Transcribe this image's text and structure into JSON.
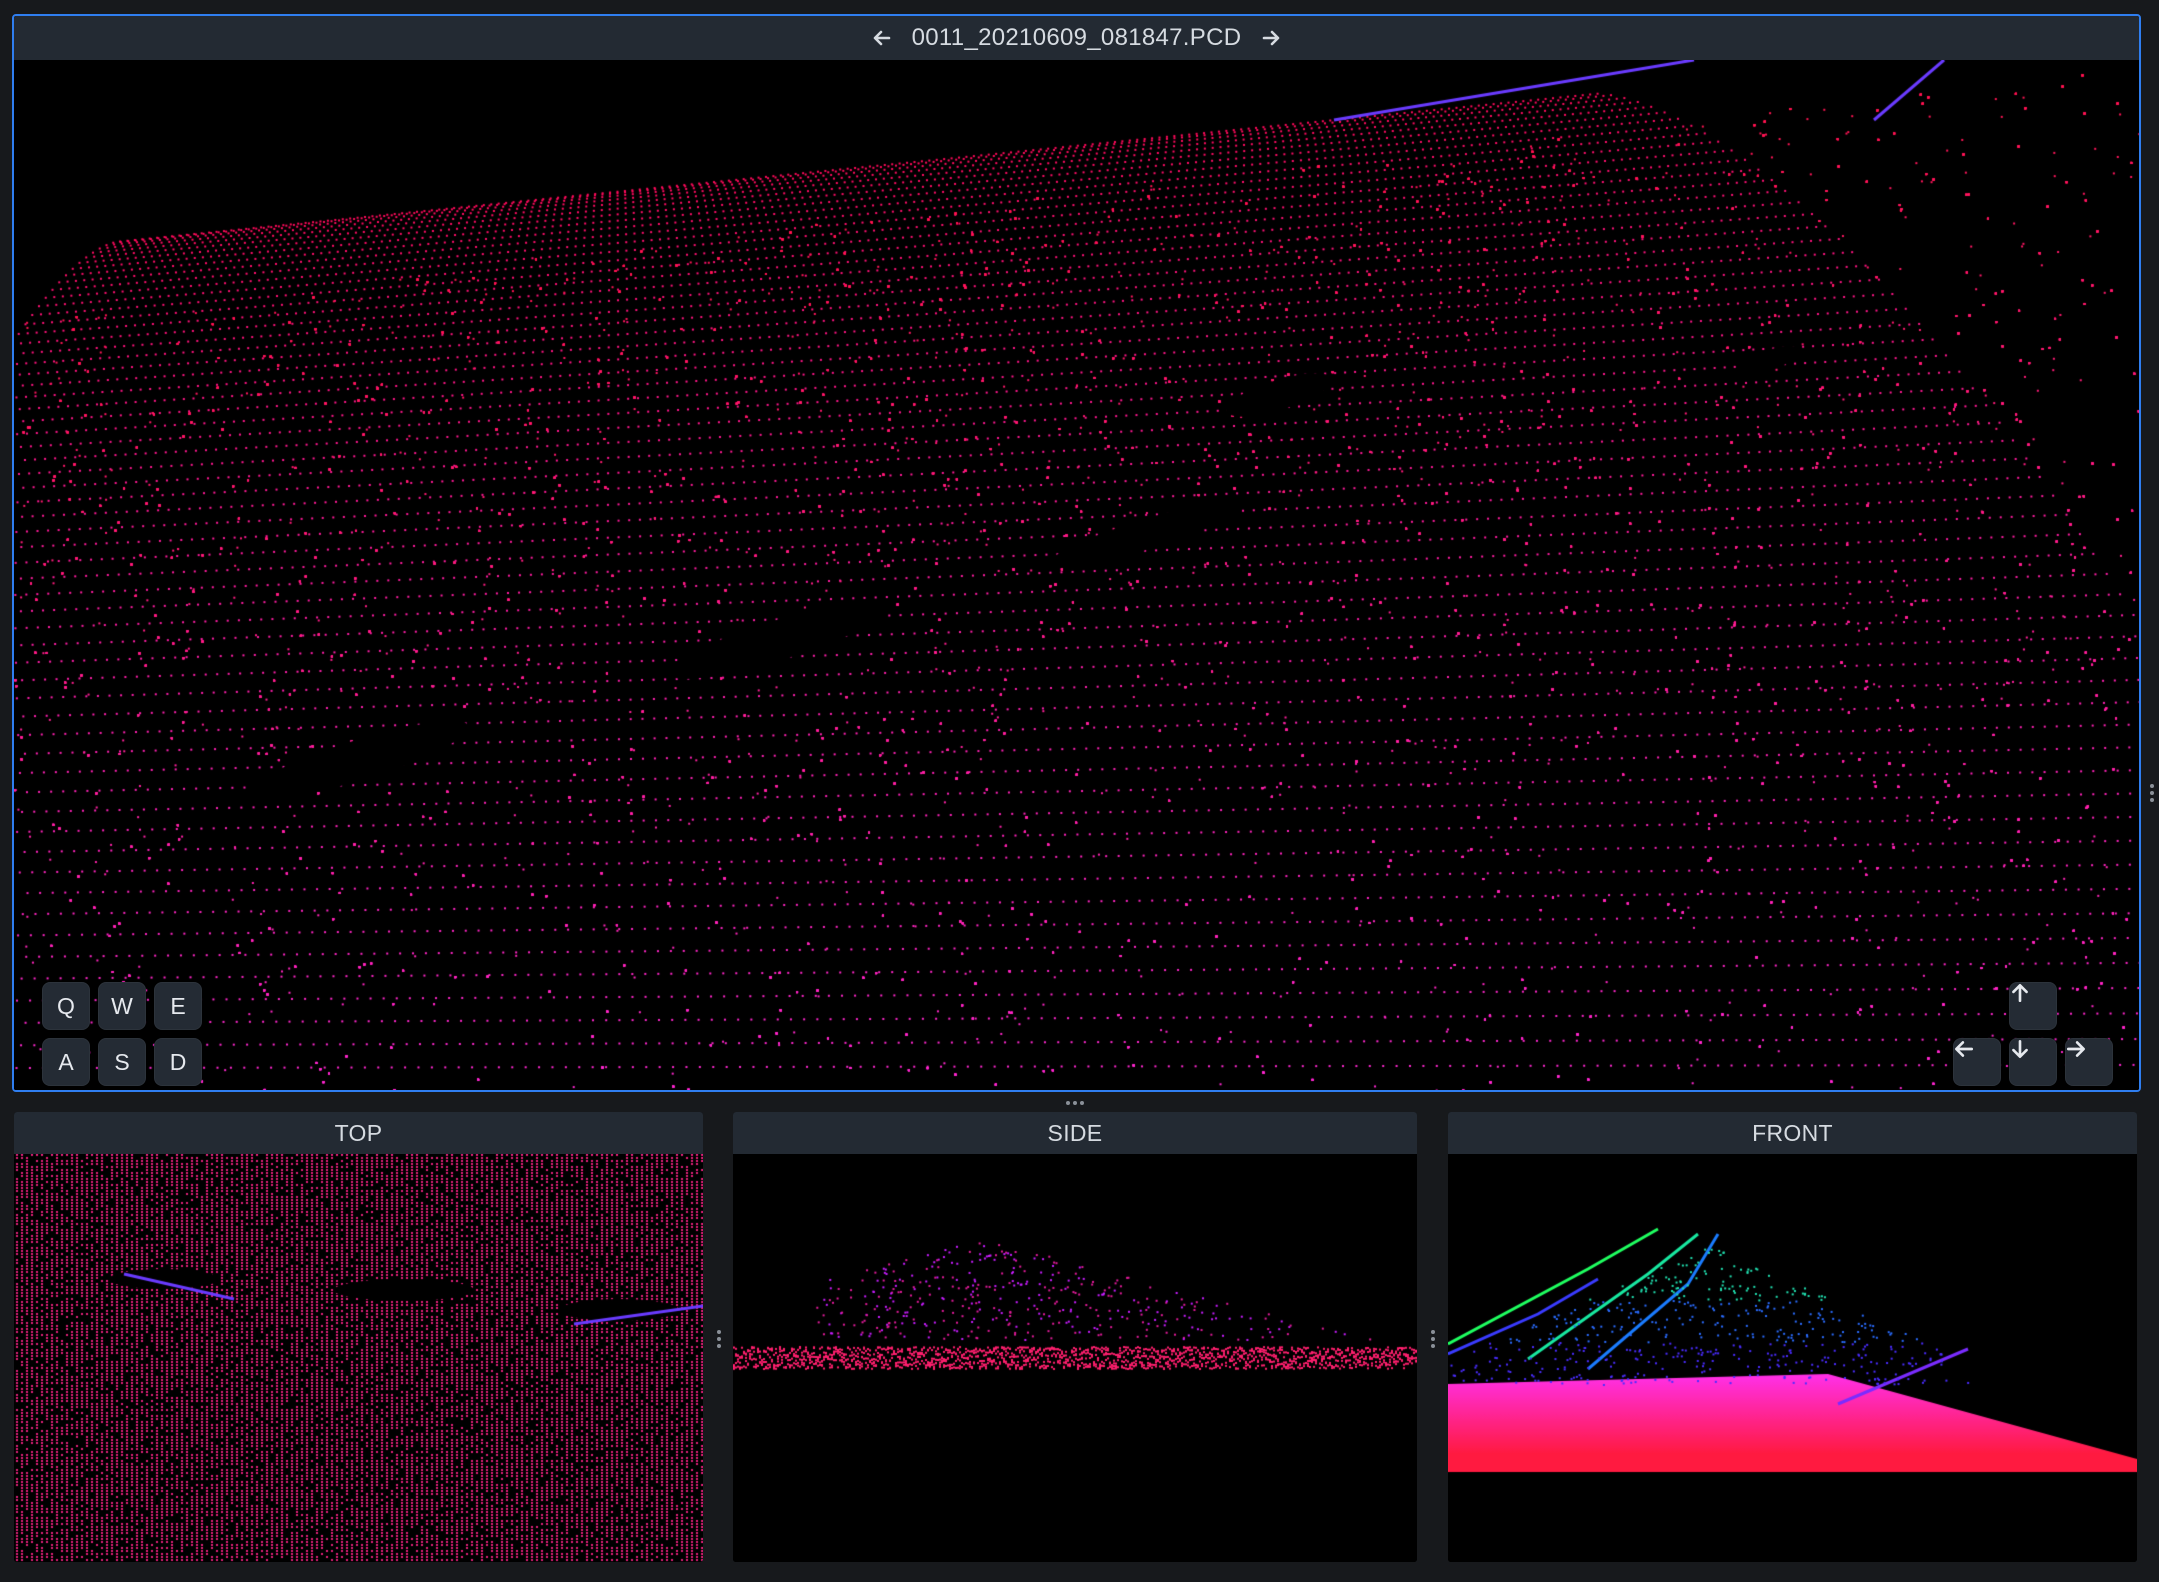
{
  "main_view": {
    "filename": "0011_20210609_081847.PCD",
    "prev_icon": "arrow-left-icon",
    "next_icon": "arrow-right-icon",
    "keys": [
      "Q",
      "W",
      "E",
      "A",
      "S",
      "D"
    ],
    "arrow_keys": [
      "arrow-up-icon",
      "arrow-left-icon",
      "arrow-down-icon",
      "arrow-right-icon"
    ]
  },
  "views": {
    "top": "TOP",
    "side": "SIDE",
    "front": "FRONT"
  },
  "colors": {
    "accent_border": "#2f7ef0",
    "header_bg": "#232a33",
    "point_primary": "#ff1f6e",
    "point_secondary": "#c81cff"
  }
}
